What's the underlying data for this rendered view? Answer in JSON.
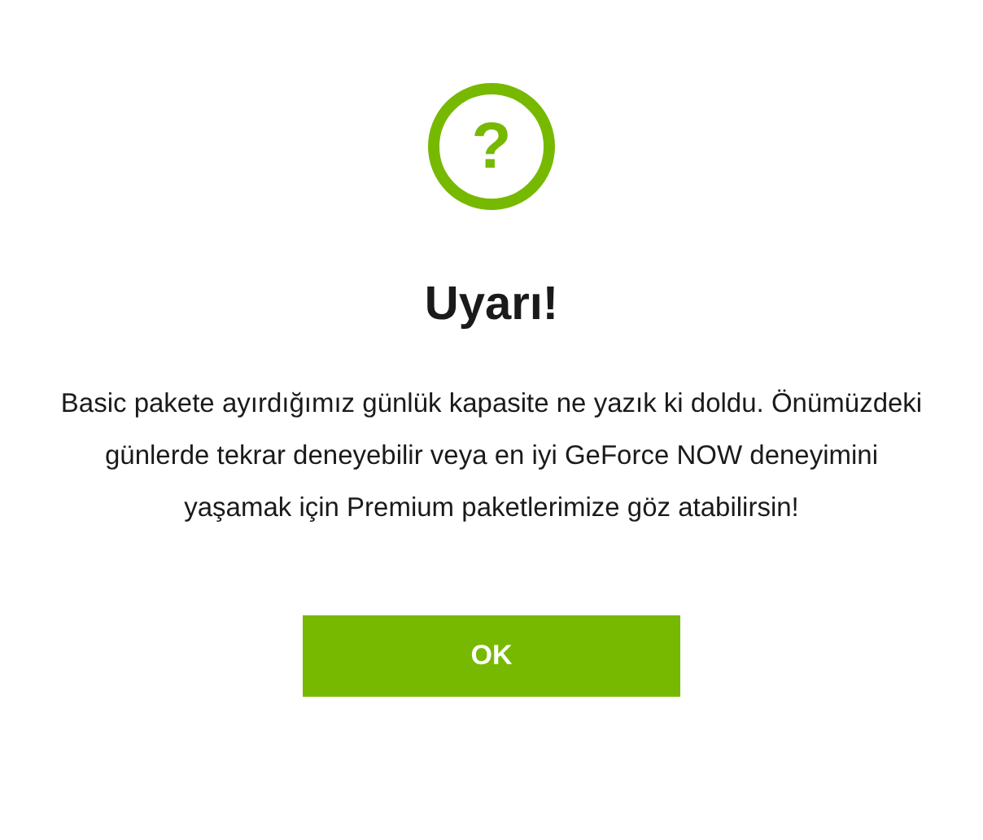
{
  "dialog": {
    "icon_text": "?",
    "title": "Uyarı!",
    "message": "Basic pakete ayırdığımız günlük kapasite ne yazık ki doldu. Önümüzdeki günlerde tekrar deneyebilir veya en iyi GeForce NOW deneyimini yaşamak için Premium paketlerimize göz atabilirsin!",
    "buttons": [
      "OK"
    ]
  }
}
